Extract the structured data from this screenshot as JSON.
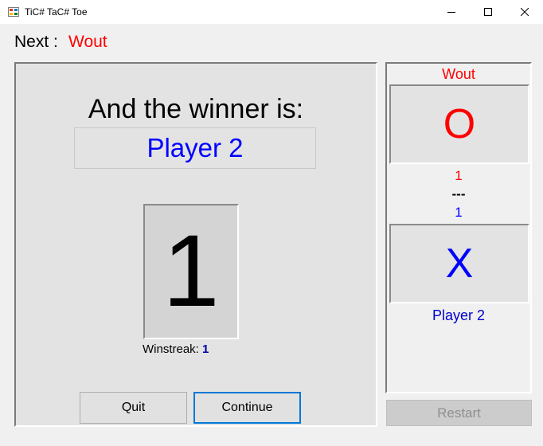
{
  "window": {
    "title": "TiC# TaC# Toe",
    "icons": {
      "app": "tic-tac-toe-app-icon",
      "minimize": "minimize-icon",
      "maximize": "maximize-icon",
      "close": "close-icon"
    }
  },
  "header": {
    "next_label": "Next :",
    "next_player": "Wout"
  },
  "result": {
    "heading": "And the winner is:",
    "winner": "Player 2",
    "big_count": "1",
    "winstreak_label": "Winstreak:",
    "winstreak_value": "1"
  },
  "buttons": {
    "quit": "Quit",
    "continue": "Continue",
    "restart": "Restart"
  },
  "scoreboard": {
    "player1": {
      "name": "Wout",
      "mark": "O",
      "score": "1"
    },
    "separator": "---",
    "player2": {
      "name": "Player 2",
      "mark": "X",
      "score": "1"
    }
  },
  "colors": {
    "player1": "#ff0000",
    "player2": "#0000ff",
    "accent": "#0078d7"
  }
}
